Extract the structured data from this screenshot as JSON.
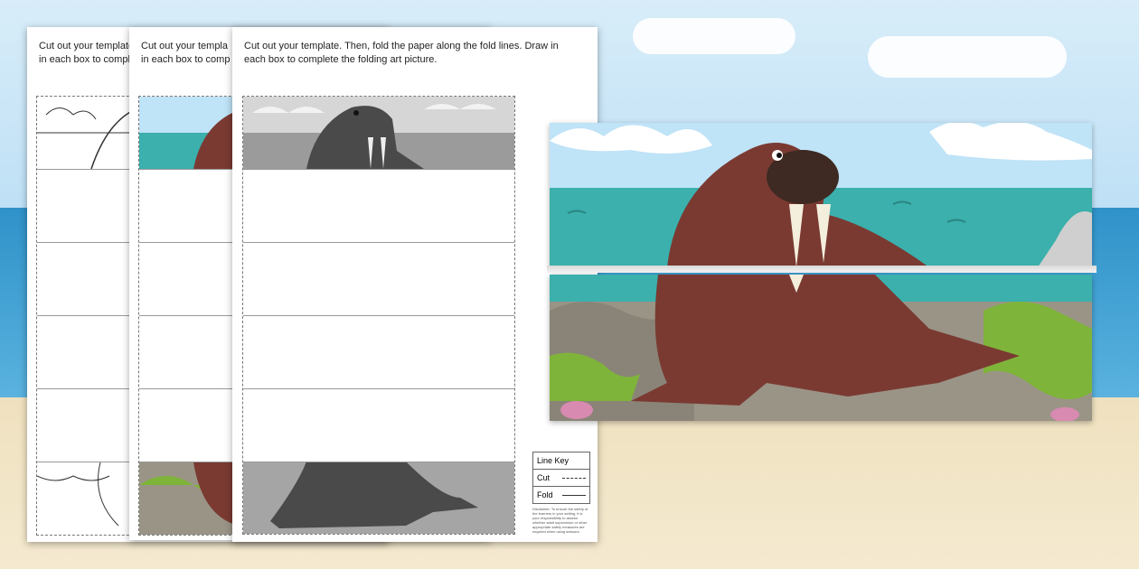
{
  "instructions_text": "Cut out your template. Then, fold the paper along the fold lines. Draw in each box to complete the folding art picture.",
  "sheet1_text": "Cut out your template",
  "sheet1_text2": "in each box to compl",
  "sheet2_text": "Cut out your templa",
  "sheet2_text2": "in each box to comp",
  "line_key": {
    "title": "Line Key",
    "cut": "Cut",
    "fold": "Fold"
  },
  "disclaimer": "Disclaimer: To ensure the safety of the learners in your setting, it is your responsibility to assess whether adult supervision or other appropriate safety measures are required when using scissors.",
  "colors": {
    "walrus": "#7a3a32",
    "sea": "#3bb0ac",
    "sky": "#bfe3f7",
    "rock": "#9a9486",
    "seaweed": "#7fb43a"
  }
}
